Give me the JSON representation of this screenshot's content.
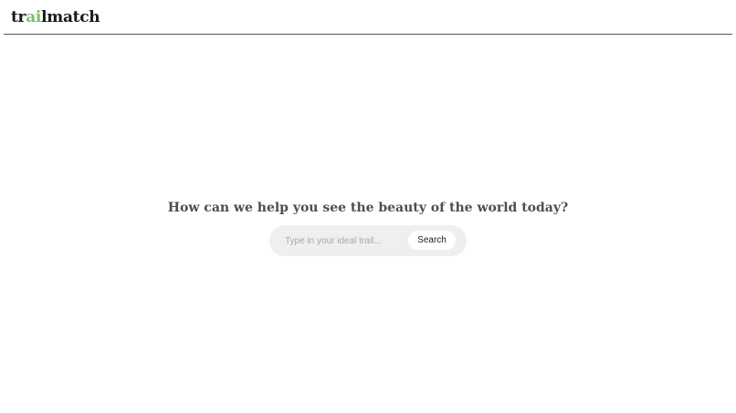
{
  "header": {
    "logo_prefix": "tr",
    "logo_accent": "ai",
    "logo_suffix": "lmatch"
  },
  "hero": {
    "headline": "How can we help you see the beauty of the world today?"
  },
  "search": {
    "placeholder": "Type in your ideal trail...",
    "value": "",
    "button_label": "Search"
  },
  "colors": {
    "accent": "#7cc16b",
    "headline": "#4a4f55",
    "search_bg": "#efefef"
  }
}
